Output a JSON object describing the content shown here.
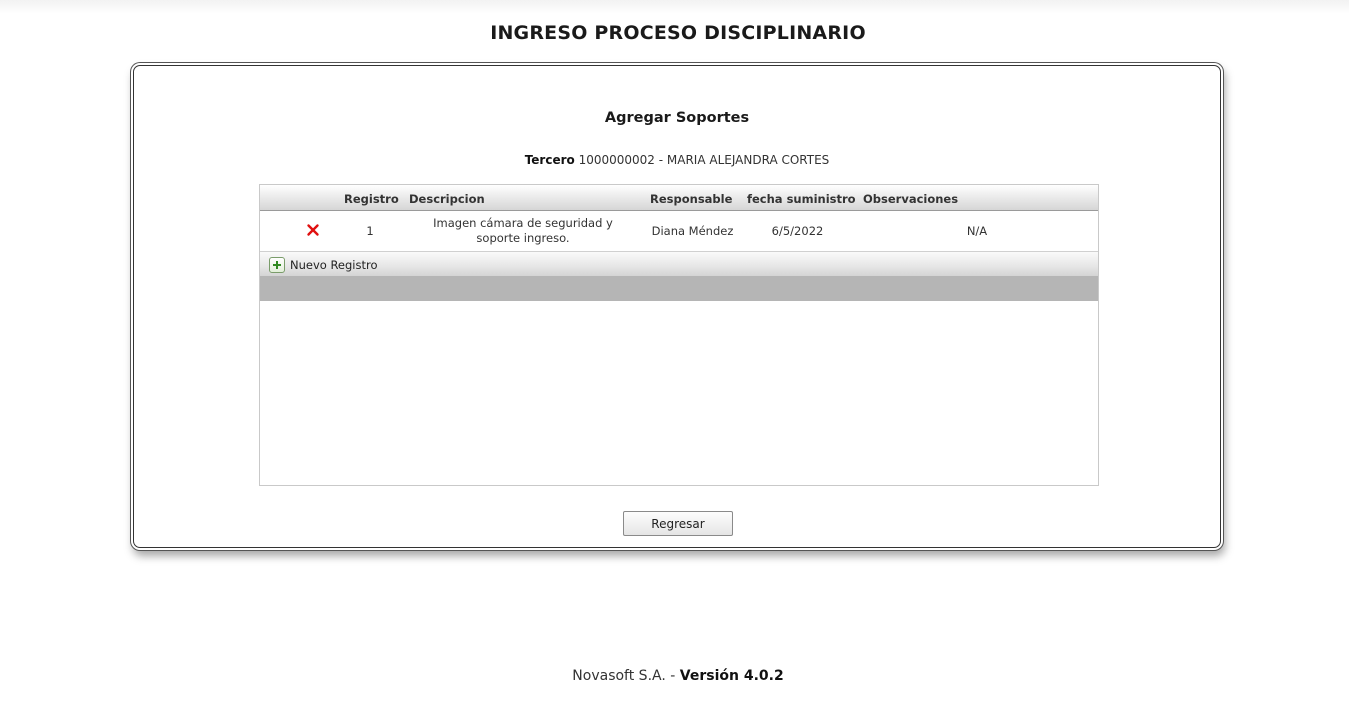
{
  "page": {
    "title": "INGRESO PROCESO DISCIPLINARIO"
  },
  "panel": {
    "title": "Agregar Soportes",
    "tercero_label": "Tercero",
    "tercero_value": "1000000002 - MARIA ALEJANDRA CORTES"
  },
  "grid": {
    "columns": {
      "registro": "Registro",
      "descripcion": "Descripcion",
      "responsable": "Responsable",
      "fecha": "fecha suministro",
      "observaciones": "Observaciones"
    },
    "rows": [
      {
        "registro": "1",
        "descripcion": "Imagen cámara de seguridad y soporte ingreso.",
        "responsable": "Diana Méndez",
        "fecha": "6/5/2022",
        "observaciones": "N/A"
      }
    ],
    "add_label": "Nuevo Registro"
  },
  "actions": {
    "back_label": "Regresar"
  },
  "footer": {
    "company": "Novasoft S.A. -",
    "version": "Versión 4.0.2"
  },
  "icons": {
    "delete": "close-icon",
    "add": "plus-icon"
  },
  "colors": {
    "delete_icon": "#e01010",
    "add_icon": "#2f8a1f"
  }
}
